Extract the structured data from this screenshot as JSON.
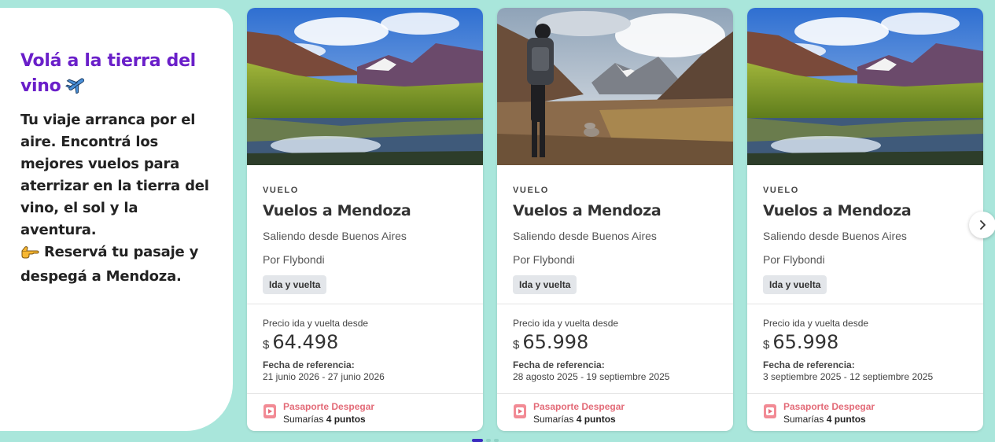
{
  "intro": {
    "title": "Volá a la tierra del vino",
    "body_line1": "Tu viaje arranca por el aire. Encontrá los mejores vuelos para aterrizar en la tierra del vino, el sol y la aventura.",
    "body_line2": "Reservá tu pasaje y despegá a Mendoza."
  },
  "cards": [
    {
      "type": "VUELO",
      "title": "Vuelos a Mendoza",
      "origin": "Saliendo desde Buenos Aires",
      "airline": "Por Flybondi",
      "badge": "Ida y vuelta",
      "price_label": "Precio ida y vuelta desde",
      "currency": "$",
      "price": "64.498",
      "ref_label": "Fecha de referencia:",
      "ref_dates": "21 junio 2026 - 27 junio 2026",
      "passport_title": "Pasaporte Despegar",
      "points_prefix": "Sumarías",
      "points_value": "4 puntos",
      "image": "lake-reflection"
    },
    {
      "type": "VUELO",
      "title": "Vuelos a Mendoza",
      "origin": "Saliendo desde Buenos Aires",
      "airline": "Por Flybondi",
      "badge": "Ida y vuelta",
      "price_label": "Precio ida y vuelta desde",
      "currency": "$",
      "price": "65.998",
      "ref_label": "Fecha de referencia:",
      "ref_dates": "28 agosto 2025 - 19 septiembre 2025",
      "passport_title": "Pasaporte Despegar",
      "points_prefix": "Sumarías",
      "points_value": "4 puntos",
      "image": "hiker-valley"
    },
    {
      "type": "VUELO",
      "title": "Vuelos a Mendoza",
      "origin": "Saliendo desde Buenos Aires",
      "airline": "Por Flybondi",
      "badge": "Ida y vuelta",
      "price_label": "Precio ida y vuelta desde",
      "currency": "$",
      "price": "65.998",
      "ref_label": "Fecha de referencia:",
      "ref_dates": "3 septiembre 2025 - 12 septiembre 2025",
      "passport_title": "Pasaporte Despegar",
      "points_prefix": "Sumarías",
      "points_value": "4 puntos",
      "image": "lake-reflection"
    }
  ],
  "colors": {
    "page_bg": "#a9e6db",
    "accent_purple": "#6a1fc9",
    "passport_pink": "#e36b78"
  },
  "icons": {
    "plane": "airplane-emoji",
    "hand": "pointing-hand-emoji",
    "next": "chevron-right-icon"
  }
}
